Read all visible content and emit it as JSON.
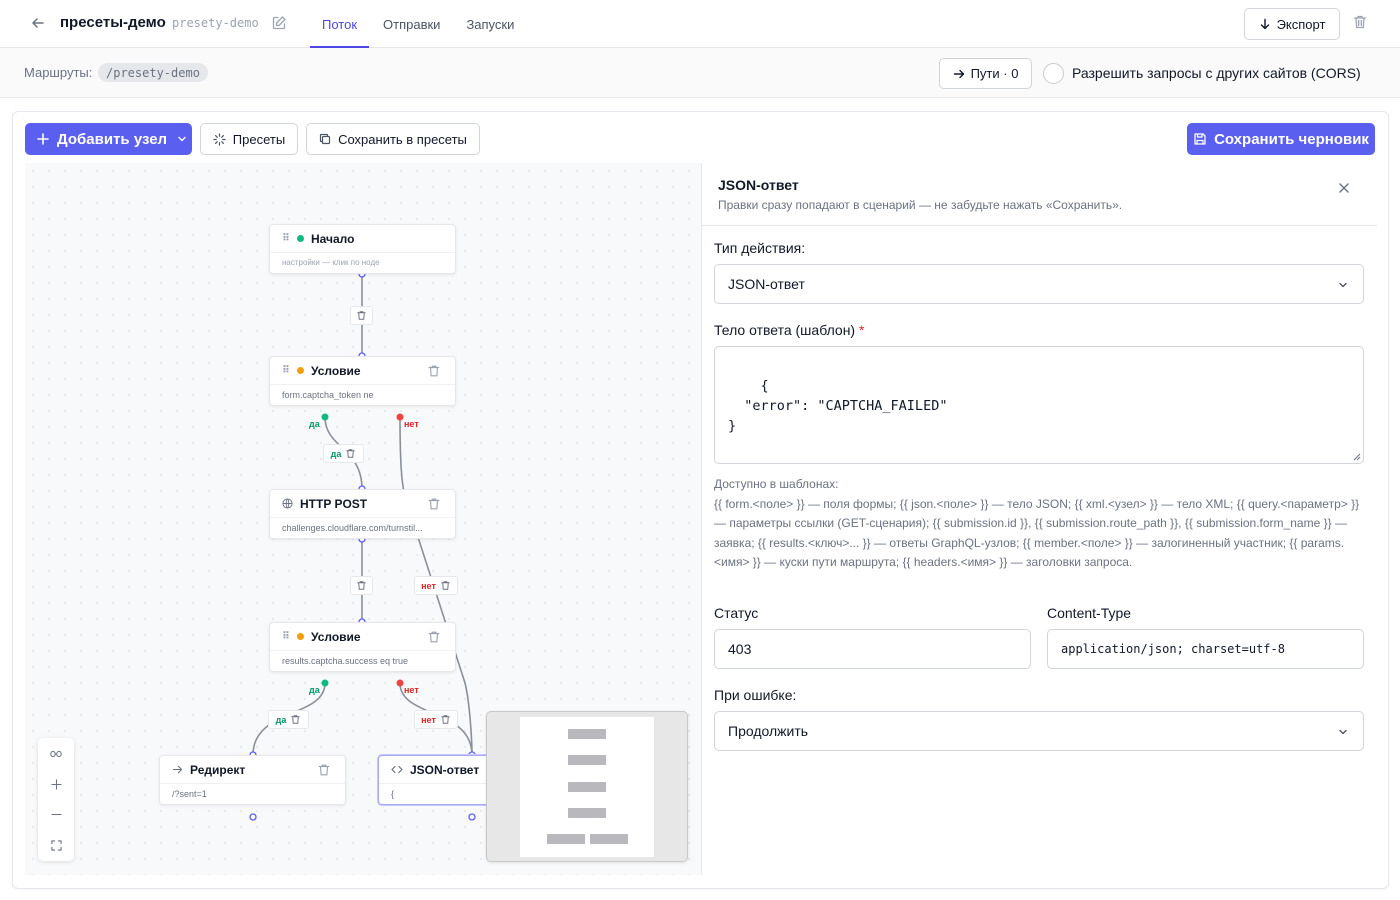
{
  "header": {
    "title": "пресеты-демо",
    "slug": "presety-demo",
    "tabs": [
      {
        "label": "Поток",
        "active": true
      },
      {
        "label": "Отправки",
        "active": false
      },
      {
        "label": "Запуски",
        "active": false
      }
    ],
    "export_label": "Экспорт"
  },
  "routes": {
    "label": "Маршруты:",
    "route": "/presety-demo",
    "paths_label": "Пути · 0",
    "cors_label": "Разрешить запросы с других сайтов (CORS)",
    "cors_checked": false
  },
  "toolbar": {
    "add_node_label": "Добавить узел",
    "presets_label": "Пресеты",
    "save_preset_label": "Сохранить в пресеты",
    "save_draft_label": "Сохранить черновик"
  },
  "colors": {
    "accent": "#5b5ff0",
    "start_dot": "#10b981",
    "condition_dot": "#f59e0b",
    "yes": "#059669",
    "no": "#dc2626"
  },
  "flow": {
    "nodes": [
      {
        "id": "start",
        "title": "Начало",
        "subtitle": "настройки — клик по ноде",
        "icon": "green-dot"
      },
      {
        "id": "cond1",
        "title": "Условие",
        "subtitle": "form.captcha_token ne",
        "icon": "amber-dot"
      },
      {
        "id": "http",
        "title": "HTTP POST",
        "subtitle": "challenges.cloudflare.com/turnstil...",
        "icon": "globe-icon"
      },
      {
        "id": "cond2",
        "title": "Условие",
        "subtitle": "results.captcha.success eq true",
        "icon": "amber-dot"
      },
      {
        "id": "redirect",
        "title": "Редирект",
        "subtitle": "/?sent=1",
        "icon": "arrow-right-icon"
      },
      {
        "id": "json",
        "title": "JSON-ответ",
        "subtitle": "{",
        "icon": "code-icon",
        "selected": true
      }
    ],
    "yes_label": "да",
    "no_label": "нет"
  },
  "form": {
    "title": "JSON-ответ",
    "subtitle": "Правки сразу попадают в сценарий — не забудьте нажать «Сохранить».",
    "action_type_label": "Тип действия:",
    "action_type_value": "JSON-ответ",
    "body_label": "Тело ответа (шаблон)",
    "required_mark": "*",
    "body_value": "{\n  \"error\": \"CAPTCHA_FAILED\"\n}",
    "help_title": "Доступно в шаблонах:",
    "help_text": "{{ form.<поле> }} — поля формы; {{ json.<поле> }} — тело JSON; {{ xml.<узел> }} — тело XML; {{ query.<параметр> }} — параметры ссылки (GET-сценария); {{ submission.id }}, {{ submission.route_path }}, {{ submission.form_name }} — заявка; {{ results.<ключ>... }} — ответы GraphQL-узлов; {{ member.<поле> }} — залогиненный участник; {{ params.<имя> }} — куски пути маршрута; {{ headers.<имя> }} — заголовки запроса.",
    "status_label": "Статус",
    "status_value": "403",
    "content_type_label": "Content-Type",
    "content_type_value": "application/json; charset=utf-8",
    "on_error_label": "При ошибке:",
    "on_error_value": "Продолжить"
  }
}
